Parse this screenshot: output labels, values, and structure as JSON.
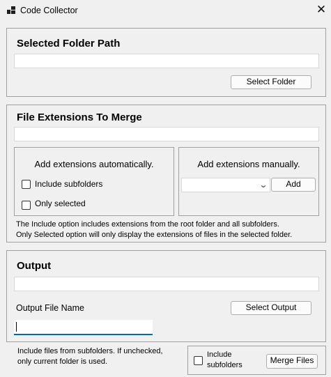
{
  "window": {
    "title": "Code Collector",
    "close_glyph": "✕",
    "icon": "app-grid-icon"
  },
  "folder_section": {
    "heading": "Selected Folder Path",
    "path_value": "",
    "select_button": "Select Folder"
  },
  "extensions_section": {
    "heading": "File Extensions To Merge",
    "extensions_value": "",
    "auto": {
      "heading": "Add extensions automatically.",
      "include_subfolders_label": "Include subfolders",
      "include_subfolders_checked": false,
      "only_selected_label": "Only selected",
      "only_selected_checked": false
    },
    "manual": {
      "heading": "Add extensions manually.",
      "dropdown_value": "",
      "dropdown_arrow": "⌄",
      "add_button": "Add"
    },
    "help_line1": "The Include option includes extensions from the root folder and all subfolders.",
    "help_line2": "Only Selected option will only display the extensions of files in the selected folder."
  },
  "output_section": {
    "heading": "Output",
    "output_value": "",
    "file_name_label": "Output File Name",
    "file_name_value": "",
    "select_output_button": "Select Output"
  },
  "footer": {
    "note_line1": "Include files from subfolders. If unchecked,",
    "note_line2": "only current folder is used.",
    "include_label_line1": "Include",
    "include_label_line2": "subfolders",
    "include_checked": false,
    "merge_button": "Merge Files"
  },
  "colors": {
    "window_bg": "#f0f0f0",
    "border": "#a0a0a0",
    "focus_accent": "#0067c0"
  }
}
